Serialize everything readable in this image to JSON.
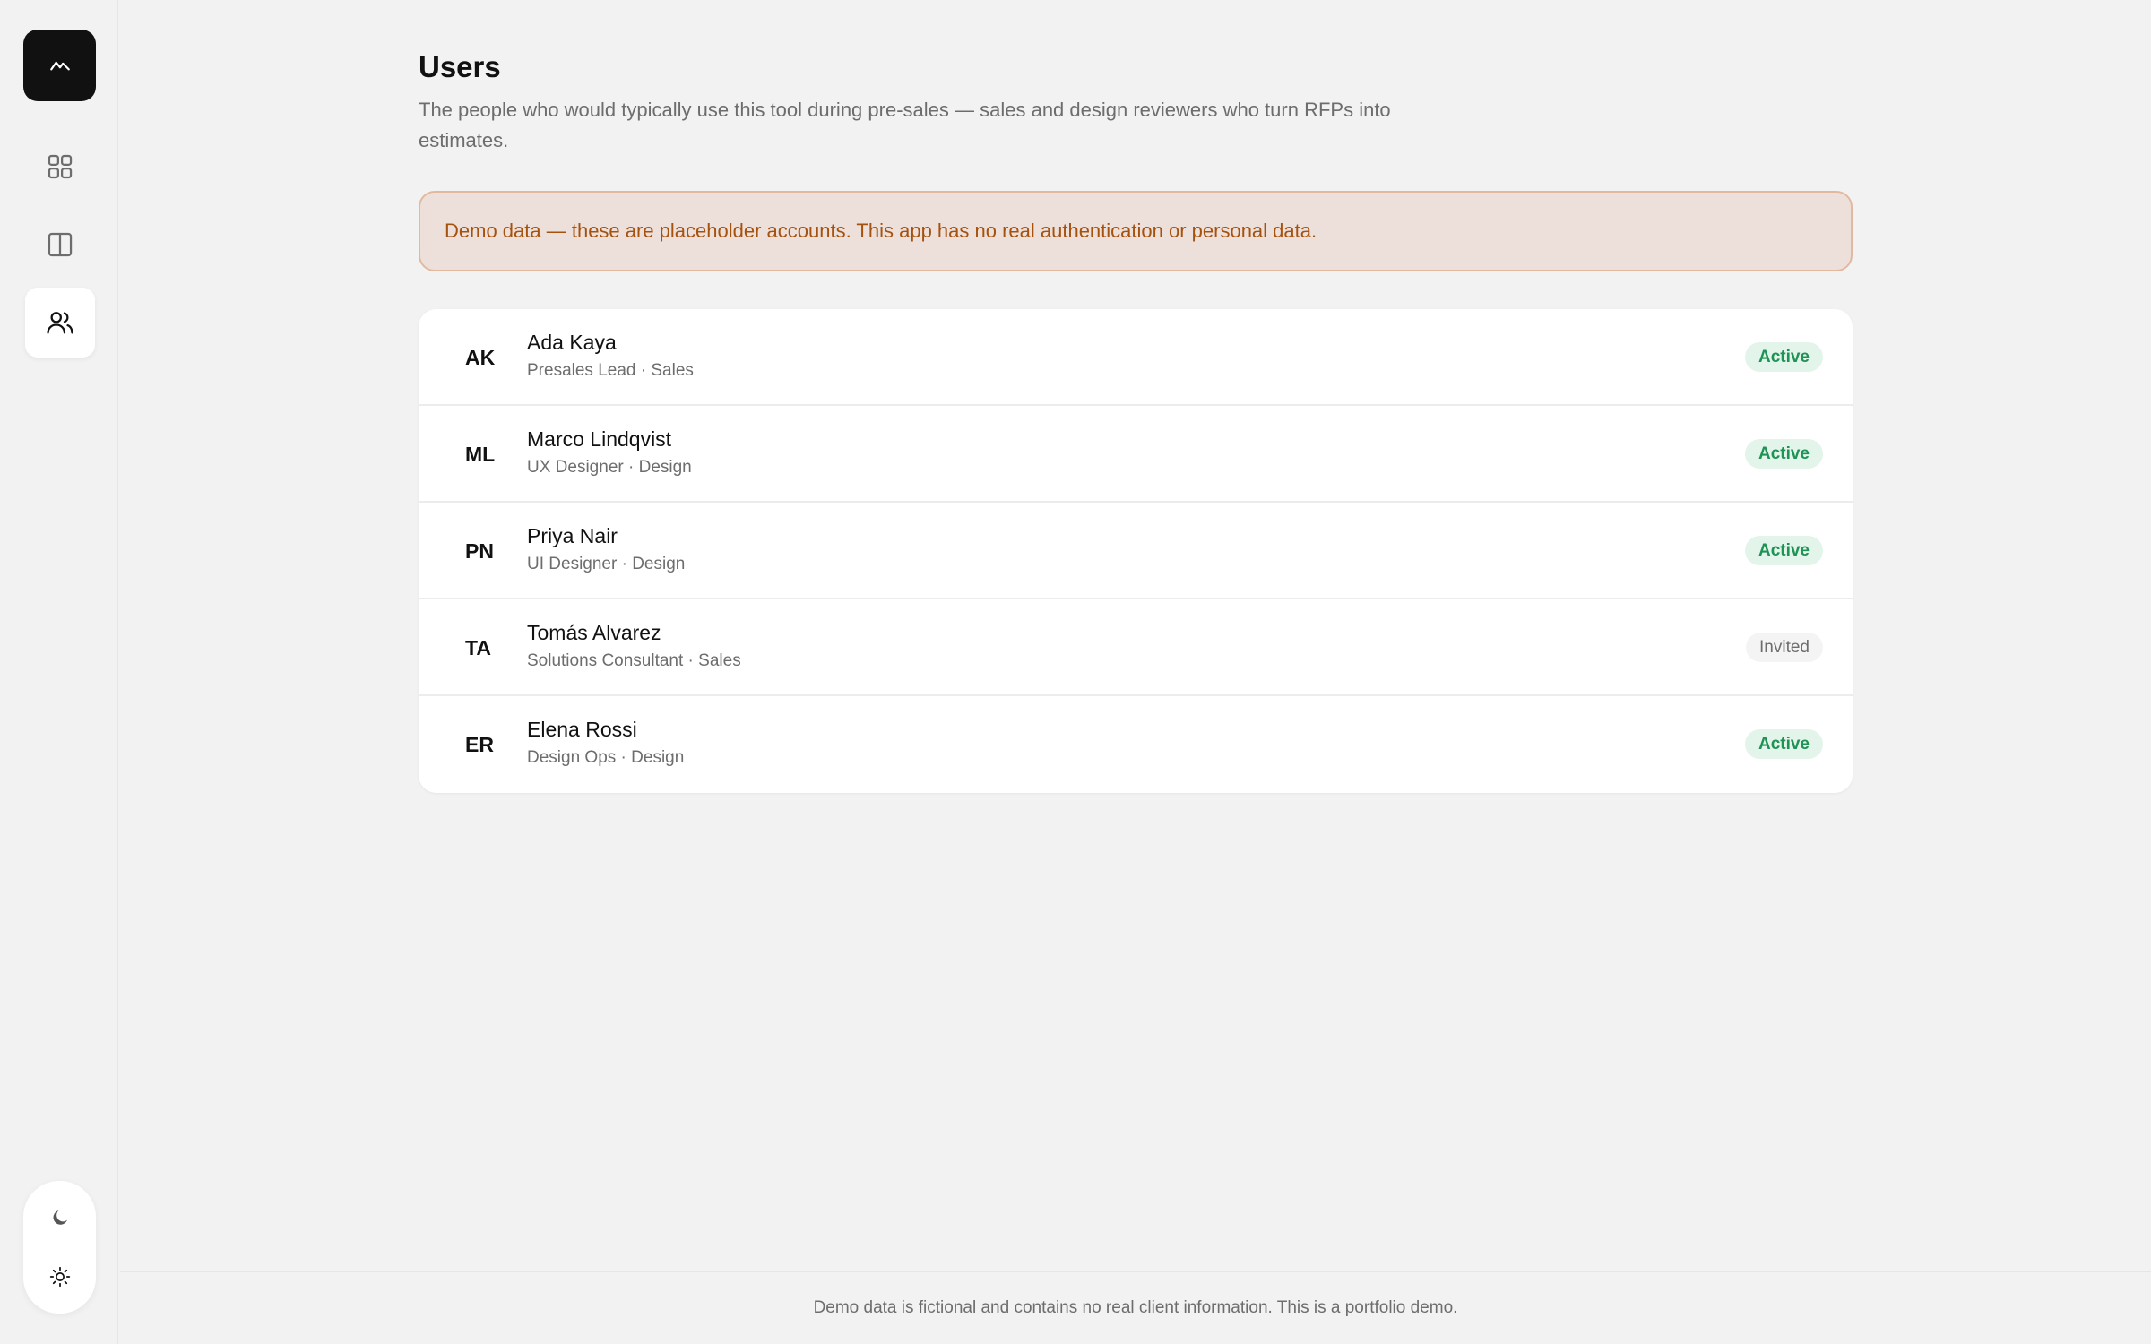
{
  "sidebar": {
    "logo_icon": "mountain-logo-icon",
    "nav": [
      {
        "icon": "grid-icon",
        "active": false
      },
      {
        "icon": "split-panel-icon",
        "active": false
      },
      {
        "icon": "users-icon",
        "active": true
      }
    ],
    "theme": {
      "dark_icon": "moon-icon",
      "light_icon": "sun-icon"
    }
  },
  "page": {
    "title": "Users",
    "description": "The people who would typically use this tool during pre-sales — sales and design reviewers who turn RFPs into estimates."
  },
  "notice": {
    "text": "Demo data — these are placeholder accounts. This app has no real authentication or personal data."
  },
  "users": [
    {
      "initials": "AK",
      "name": "Ada Kaya",
      "role": "Presales Lead · Sales",
      "status": "Active"
    },
    {
      "initials": "ML",
      "name": "Marco Lindqvist",
      "role": "UX Designer · Design",
      "status": "Active"
    },
    {
      "initials": "PN",
      "name": "Priya Nair",
      "role": "UI Designer · Design",
      "status": "Active"
    },
    {
      "initials": "TA",
      "name": "Tomás Alvarez",
      "role": "Solutions Consultant · Sales",
      "status": "Invited"
    },
    {
      "initials": "ER",
      "name": "Elena Rossi",
      "role": "Design Ops · Design",
      "status": "Active"
    }
  ],
  "footer": {
    "text": "Demo data is fictional and contains no real client information. This is a portfolio demo."
  },
  "colors": {
    "accent_dark": "#111111",
    "notice_bg": "#ede0da",
    "notice_border": "#e2b9a0",
    "notice_text": "#a6520f",
    "active_bg": "#e3f5ea",
    "active_text": "#1f9255",
    "muted_text": "#6d6d6d"
  }
}
